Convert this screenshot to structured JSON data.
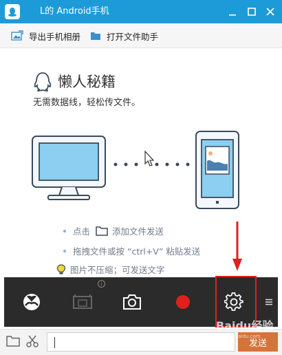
{
  "window": {
    "title": "L的 Android手机"
  },
  "toolbar": {
    "export_album": "导出手机相册",
    "open_file_assistant": "打开文件助手"
  },
  "hero": {
    "title": "懒人秘籍",
    "subtitle": "无需数据线，轻松传文件。"
  },
  "tips": [
    {
      "prefix": "点击",
      "suffix": "添加文件发送"
    },
    {
      "text": "拖拽文件或按 “ctrl+V” 粘贴发送"
    },
    {
      "text": "图片不压缩；可发送文字"
    }
  ],
  "controls": {
    "icons": [
      "xbox-icon",
      "screen-mirror-icon",
      "camera-icon",
      "record-icon",
      "settings-icon",
      "menu-icon"
    ],
    "record_color": "#e0201c",
    "highlight_color": "#e0201c"
  },
  "input": {
    "value": "",
    "send_label": "发送"
  },
  "watermark": {
    "text": "Baidu经验",
    "sub": "jingyan.baidu.com"
  },
  "colors": {
    "titlebar": "#1d9bd8",
    "accent": "#3a8fd0",
    "send": "#d4743a"
  }
}
